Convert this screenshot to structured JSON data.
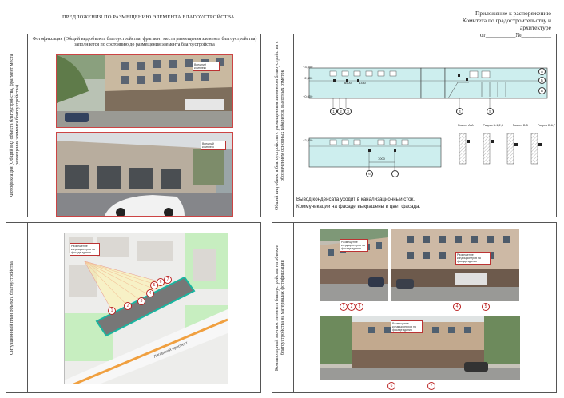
{
  "header": {
    "left_title": "ПРЕДЛОЖЕНИЯ ПО РАЗМЕЩЕНИЮ ЭЛЕМЕНТА БЛАГОУСТРОЙСТВА",
    "right_line1": "Приложение к распоряжению",
    "right_line2": "Комитета по градостроительству и архитектуре",
    "right_line3": "от__________№__________"
  },
  "panels": {
    "photo_fixation": {
      "side_label": "Фотофиксация (Общий вид объекта благоустройства, фрагмент места размещения элемента благоустройства)",
      "caption_line1": "Фотофиксация (Общий вид объекта благоустройства, фрагмент места размещения элемента благоустройства)",
      "caption_line2": "заполняется по состоянию до размещения элемента благоустройства",
      "photo1_note": "Внешний комплекс",
      "photo2_note": "Внешний комплекс"
    },
    "situational_plan": {
      "side_label": "Ситуационный план объекта благоустройства",
      "note": "Размещение кондиционеров на фасаде здания",
      "street_label": "Лиговский проспект",
      "building_number": "16",
      "markers": [
        "1",
        "2",
        "3",
        "4",
        "5",
        "6",
        "7"
      ]
    },
    "facade": {
      "side_label": "Общий вид объекта благоустройства с размещенным элементом благоустройства с обозначением основных габаритов, высотных отметок",
      "levels_top": [
        "+3,300",
        "+2,500",
        "+0,000"
      ],
      "level_bottom": "+2,500",
      "dims_top": [
        "6500",
        "1330"
      ],
      "dim_bottom": "7000",
      "markers_top": [
        "1",
        "2",
        "3",
        "4",
        "5"
      ],
      "markers_bottom": [
        "6",
        "7"
      ],
      "axes": [
        "А",
        "Б",
        "В"
      ],
      "section_titles": [
        "Разрез А-А",
        "Разрез Б-1,2,3",
        "Разрез В-5",
        "Разрез Б-6,7"
      ],
      "note_line1": "Вывод конденсата уходит в канализационный сток.",
      "note_line2": "Коммуникации на фасаде выкрашены в цвет фасада."
    },
    "montage": {
      "side_label": "Компьютерный монтаж элемента благоустройства на объекте благоустройства на материалах фотофиксации",
      "photo1_note": "Размещение кондиционеров на фасаде здания",
      "photo2_note": "Размещение кондиционеров на фасаде здания",
      "photo3_note": "Размещение кондиционеров на фасаде здания",
      "markers_p1": [
        "1",
        "2",
        "3"
      ],
      "markers_p2": [
        "4",
        "5"
      ],
      "markers_p3": [
        "6",
        "7"
      ]
    }
  },
  "colors": {
    "frame": "#555555",
    "marker_red": "#bb2222",
    "building_fill": "#777777",
    "building_outline": "#19b5a0",
    "facade_cyan": "#cdeeee",
    "park_green": "#c7eec0",
    "road_orange": "#f0a040"
  }
}
